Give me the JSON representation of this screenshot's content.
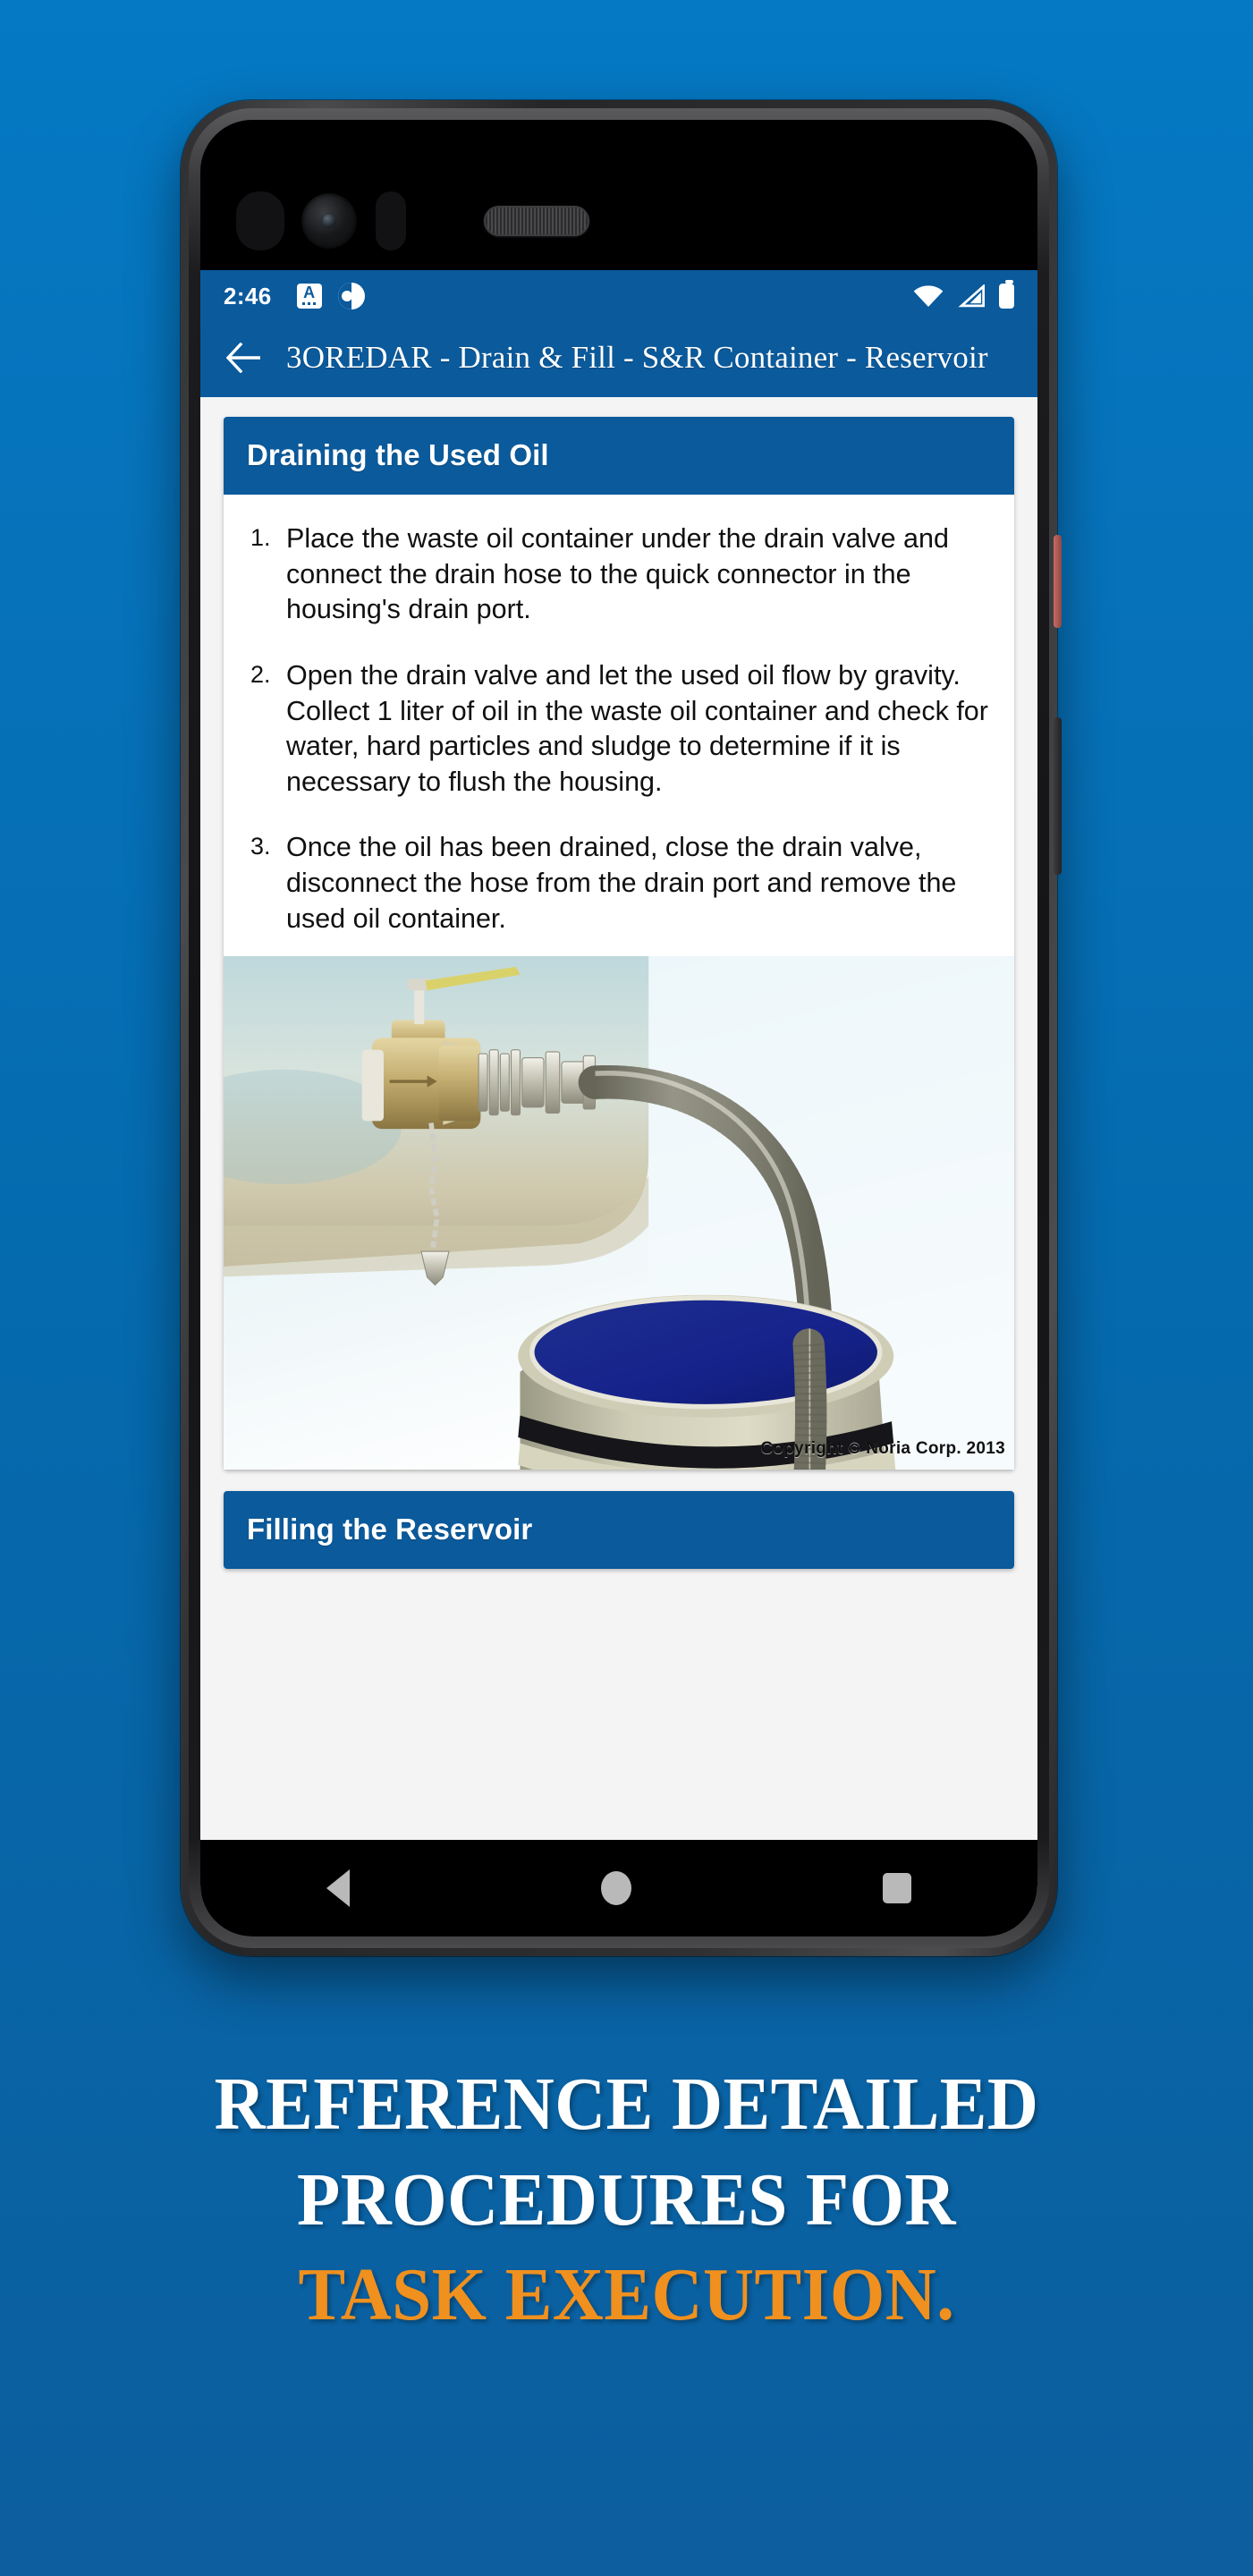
{
  "background": {
    "color_top": "#0579c4",
    "color_bottom": "#0c5e9e"
  },
  "device": {
    "frame_color": "#2e2e30",
    "power_button_color": "#c96a62"
  },
  "status_bar": {
    "time": "2:46",
    "icons_left": [
      "translate-icon",
      "contrast-circle-icon"
    ],
    "icons_right": [
      "wifi-icon",
      "cell-signal-icon",
      "battery-icon"
    ],
    "background": "#0a5a9c"
  },
  "app_bar": {
    "back_icon": "back-arrow-icon",
    "title": "3OREDAR - Drain & Fill - S&R Container - Reservoir",
    "background": "#0a5a9c"
  },
  "cards": [
    {
      "header": "Draining the Used Oil",
      "steps": [
        "Place the waste oil container under the drain valve and connect the drain hose to the quick connector in the housing's drain port.",
        "Open the drain valve and let the used oil flow by gravity. Collect 1 liter of oil in the waste oil container and check for water, hard particles and sludge to determine if it is necessary to flush the housing.",
        "Once the oil has been drained, close the drain valve, disconnect the hose from the drain port and remove the used oil container."
      ],
      "image": {
        "alt": "drain-valve-hose-into-drum-illustration",
        "copyright": "Copyright © Noria Corp. 2013"
      }
    },
    {
      "header": "Filling the Reservoir",
      "steps": [],
      "image": null
    }
  ],
  "nav_bar": {
    "items": [
      "back-nav-button",
      "home-nav-button",
      "recents-nav-button"
    ],
    "background": "#000000"
  },
  "caption": {
    "line1": "REFERENCE DETAILED",
    "line2": "PROCEDURES FOR",
    "line3": "TASK EXECUTION.",
    "color_primary": "#ffffff",
    "color_accent": "#f0901e"
  }
}
